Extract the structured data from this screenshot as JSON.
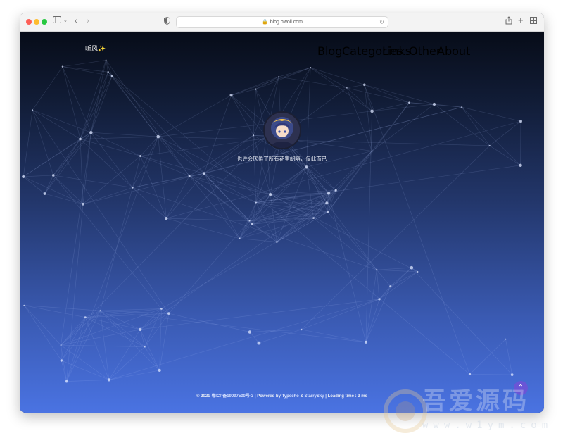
{
  "browser": {
    "url": "blog.owoii.com"
  },
  "site": {
    "brand": "听风✨",
    "nav": [
      "Blog",
      "Categories",
      "Links",
      "Other",
      "About"
    ],
    "motto": "也许会厌倦了所有花里胡哨，仅此而已"
  },
  "footer": {
    "prefix": "© 2021",
    "icp": "粤ICP备19097500号-3",
    "powered_label": "| Powered by",
    "typecho": "Typecho",
    "amp": "&",
    "theme": "StarrySky",
    "loading": "| Loading time : 3 ms"
  },
  "watermark": {
    "title": "吾爱源码",
    "url": "www.w1ym.com"
  },
  "colors": {
    "accent": "#6a55d6",
    "gradient_top": "#070c18",
    "gradient_bottom": "#4a73e2"
  },
  "icons": [
    "sidebar-icon",
    "back-icon",
    "forward-icon",
    "shield-icon",
    "lock-icon",
    "reload-icon",
    "share-icon",
    "new-tab-icon",
    "tabs-overview-icon",
    "arrow-up-icon"
  ]
}
